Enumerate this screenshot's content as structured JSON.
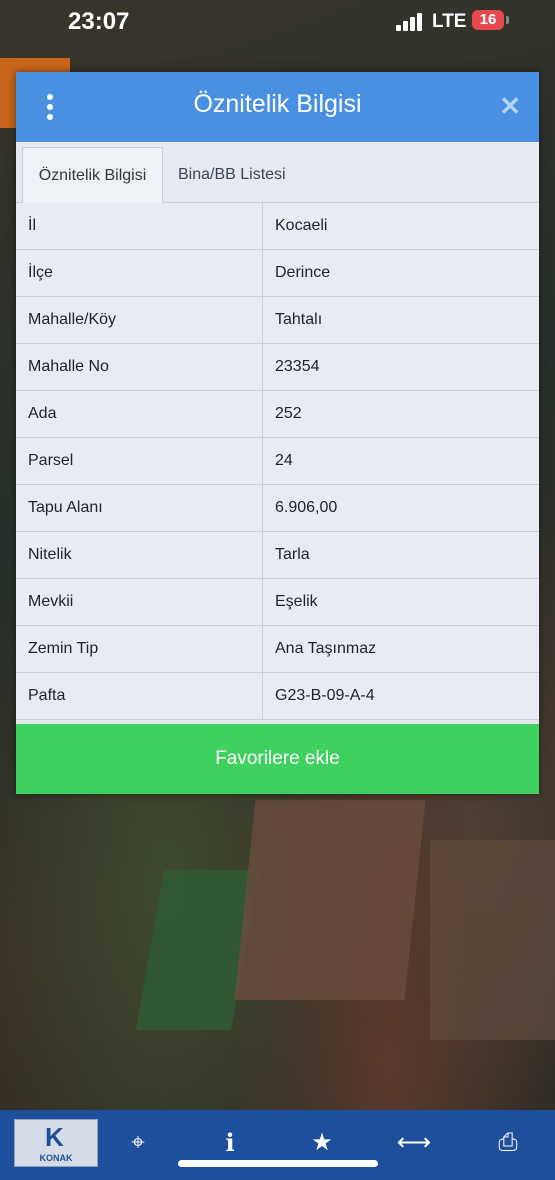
{
  "status_bar": {
    "time": "23:07",
    "network": "LTE",
    "battery": "16"
  },
  "dialog": {
    "title": "Öznitelik Bilgisi",
    "close_glyph": "✕",
    "tabs": [
      {
        "label": "Öznitelik Bilgisi",
        "active": true
      },
      {
        "label": "Bina/BB Listesi",
        "active": false
      }
    ],
    "rows": [
      {
        "key": "İl",
        "value": "Kocaeli"
      },
      {
        "key": "İlçe",
        "value": "Derince"
      },
      {
        "key": "Mahalle/Köy",
        "value": "Tahtalı"
      },
      {
        "key": "Mahalle No",
        "value": "23354"
      },
      {
        "key": "Ada",
        "value": "252"
      },
      {
        "key": "Parsel",
        "value": "24"
      },
      {
        "key": "Tapu Alanı",
        "value": "6.906,00"
      },
      {
        "key": "Nitelik",
        "value": "Tarla"
      },
      {
        "key": "Mevkii",
        "value": "Eşelik"
      },
      {
        "key": "Zemin Tip",
        "value": "Ana Taşınmaz"
      },
      {
        "key": "Pafta",
        "value": "G23-B-09-A-4"
      }
    ],
    "favorite_button": "Favorilere ekle"
  },
  "toolbar": {
    "logo_letter": "K",
    "logo_text": "KONAK",
    "tools": [
      {
        "icon": "crosshair-icon",
        "glyph": "⌖"
      },
      {
        "icon": "info-icon",
        "glyph": "i"
      },
      {
        "icon": "star-icon",
        "glyph": "★"
      },
      {
        "icon": "measure-icon",
        "glyph": "⟷"
      },
      {
        "icon": "print-icon",
        "glyph": "⎙"
      }
    ]
  },
  "colors": {
    "header": "#4a90e2",
    "favorite": "#3ed160",
    "toolbar": "#1d4f9c"
  }
}
